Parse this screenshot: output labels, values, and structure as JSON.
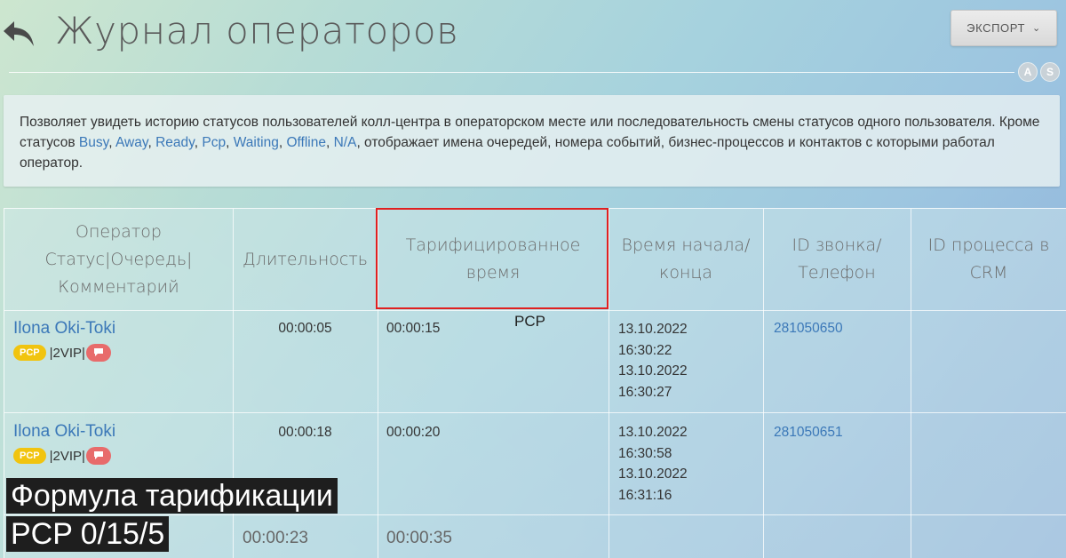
{
  "header": {
    "title": "Журнал операторов",
    "export_label": "ЭКСПОРТ",
    "avatars": [
      "A",
      "S"
    ]
  },
  "info": {
    "text_before": "Позволяет увидеть историю статусов пользователей колл-центра в операторском месте или последовательность смены статусов одного пользователя. Кроме статусов ",
    "statuses": [
      "Busy",
      "Away",
      "Ready",
      "Pcp",
      "Waiting",
      "Offline",
      "N/A"
    ],
    "text_after": ", отображает имена очередей, номера событий, бизнес-процессов и контактов с которыми работал оператор."
  },
  "table": {
    "headers": {
      "operator_line1": "Оператор",
      "operator_line2": "Статус|Очередь|",
      "operator_line3": "Комментарий",
      "duration": "Длительность",
      "billed_line1": "Тарифицированное",
      "billed_line2": "время",
      "time_line1": "Время начала/",
      "time_line2": "конца",
      "call_line1": "ID звонка/",
      "call_line2": "Телефон",
      "crm_line1": "ID процесса в",
      "crm_line2": "CRM"
    },
    "rows": [
      {
        "operator": "Ilona Oki-Toki",
        "status_badge": "PCP",
        "queue": "|2VIP|",
        "duration": "00:00:05",
        "billed": "00:00:15",
        "start_date": "13.10.2022",
        "start_time": "16:30:22",
        "end_date": "13.10.2022",
        "end_time": "16:30:27",
        "call_id": "281050650"
      },
      {
        "operator": "Ilona Oki-Toki",
        "status_badge": "PCP",
        "queue": "|2VIP|",
        "duration": "00:00:18",
        "billed": "00:00:20",
        "start_date": "13.10.2022",
        "start_time": "16:30:58",
        "end_date": "13.10.2022",
        "end_time": "16:31:16",
        "call_id": "281050651"
      },
      {
        "duration": "00:00:23",
        "billed": "00:00:35"
      }
    ]
  },
  "annotations": {
    "pcp_note": "PCP",
    "formula_line1": "Формула тарификации",
    "formula_line2": "PCP 0/15/5"
  },
  "colors": {
    "link": "#3b78b8",
    "pcp_badge": "#f1c40f",
    "comment_badge": "#e86b6b",
    "highlight": "#e02020"
  }
}
